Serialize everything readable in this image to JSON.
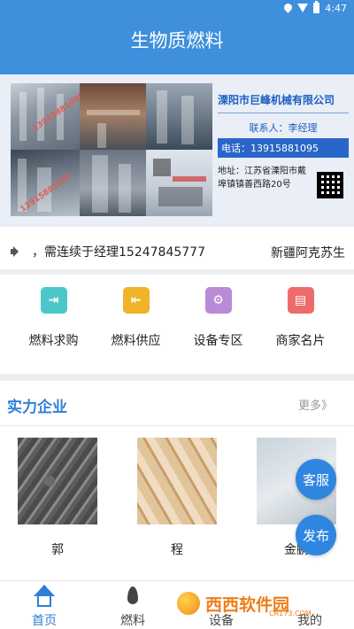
{
  "status_bar": {
    "time": "4:47"
  },
  "app": {
    "title": "生物质燃料"
  },
  "banner": {
    "company_name": "溧阳市巨峰机械有限公司",
    "contact": "联系人：李经理",
    "phone": "电话：13915881095",
    "address": "地址：江苏省溧阳市戴埠镇镇善西路20号",
    "watermark_1": "13915881095",
    "watermark_2": "13915881095"
  },
  "notice": {
    "text": "，需连续于经理15247845777",
    "text2": "新疆阿克苏生"
  },
  "menu": [
    {
      "label": "燃料求购",
      "icon": "enter-icon",
      "color": "#4cc7c9"
    },
    {
      "label": "燃料供应",
      "icon": "exit-icon",
      "color": "#f0b429"
    },
    {
      "label": "设备专区",
      "icon": "gear-icon",
      "color": "#b98ad6"
    },
    {
      "label": "商家名片",
      "icon": "card-icon",
      "color": "#ee6b6b"
    }
  ],
  "section": {
    "title": "实力企业",
    "more": "更多》"
  },
  "companies": [
    {
      "label": "郭"
    },
    {
      "label": "程"
    },
    {
      "label": "金鹏"
    }
  ],
  "floating": {
    "service": "客服",
    "publish": "发布"
  },
  "bottom_nav": [
    {
      "label": "首页",
      "icon": "home-icon",
      "active": true
    },
    {
      "label": "燃料",
      "icon": "flame-icon",
      "active": false
    },
    {
      "label": "设备",
      "icon": "equipment-icon",
      "active": false
    },
    {
      "label": "我的",
      "icon": "user-icon",
      "active": false
    }
  ],
  "overlay_logo": {
    "text": "西西软件园",
    "sub": "CR173.COM"
  },
  "colors": {
    "primary": "#3f8fdc",
    "accent": "#2f7fd6"
  }
}
